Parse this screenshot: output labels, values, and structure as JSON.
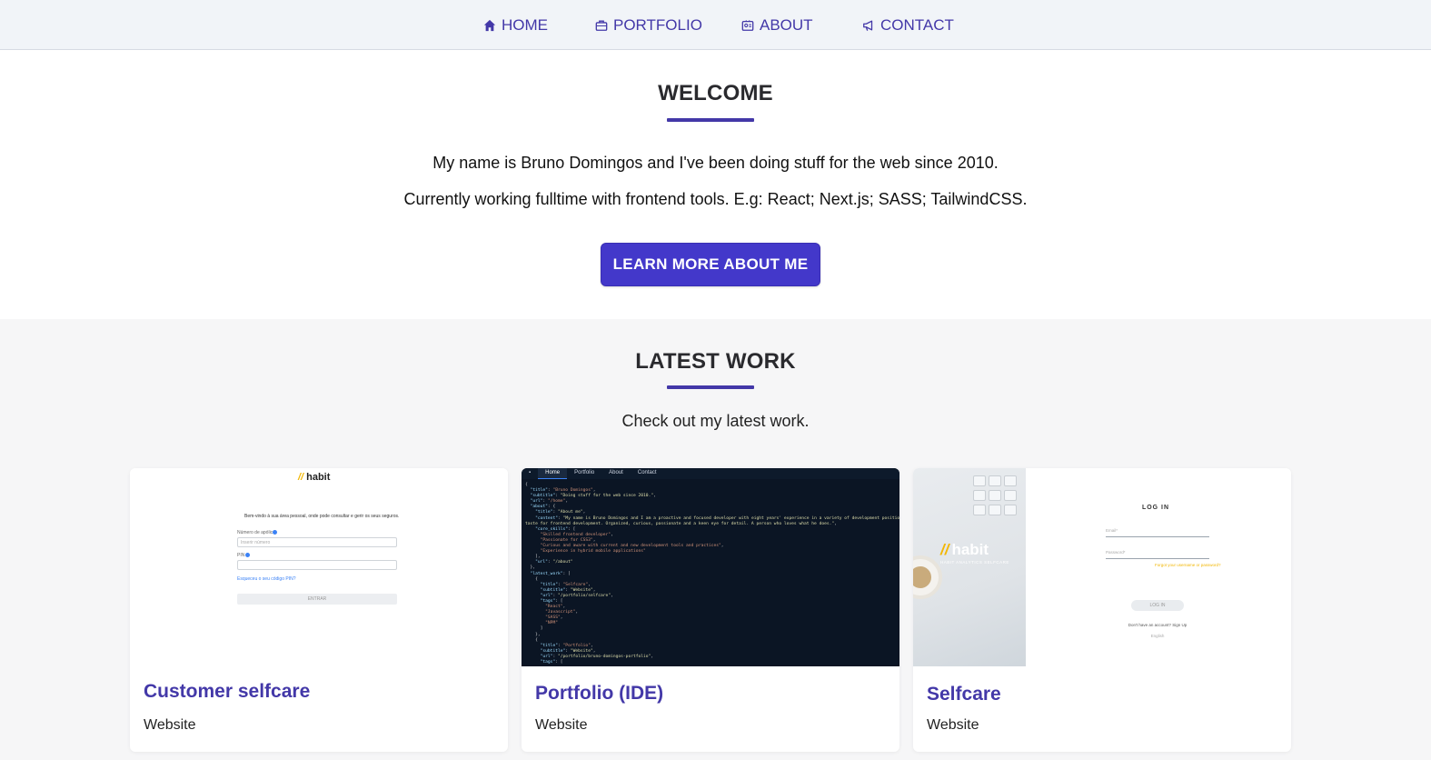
{
  "nav": {
    "items": [
      {
        "label": "HOME",
        "icon": "home-icon"
      },
      {
        "label": "PORTFOLIO",
        "icon": "briefcase-icon"
      },
      {
        "label": "ABOUT",
        "icon": "id-card-icon"
      },
      {
        "label": "CONTACT",
        "icon": "megaphone-icon"
      }
    ]
  },
  "welcome": {
    "title": "WELCOME",
    "line1": "My name is Bruno Domingos and I've been doing stuff for the web since 2010.",
    "line2": "Currently working fulltime with frontend tools. E.g: React; Next.js; SASS; TailwindCSS.",
    "cta": "LEARN MORE ABOUT ME"
  },
  "latest": {
    "title": "LATEST WORK",
    "subtitle": "Check out my latest work.",
    "cards": [
      {
        "title": "Customer selfcare",
        "subtitle": "Website"
      },
      {
        "title": "Portfolio (IDE)",
        "subtitle": "Website"
      },
      {
        "title": "Selfcare",
        "subtitle": "Website"
      }
    ]
  },
  "thumbs": {
    "habit_logo": "habit",
    "habit_welcome": "Bem-vindo à sua área pessoal, onde pode consultar e gerir os seus seguros.",
    "habit_field1": "Número de apólice",
    "habit_field1_ph": "Inserir número",
    "habit_field2": "PIN",
    "habit_link": "Esqueceu o seu código PIN?",
    "habit_btn": "ENTRAR",
    "ide_tabs": [
      "Home",
      "Portfolio",
      "About",
      "Contact"
    ],
    "selfcare_logo": "habit",
    "selfcare_logo_sub": "HABIT ANALYTICS SELFCARE",
    "selfcare_login": "LOG IN",
    "selfcare_email": "Email*",
    "selfcare_password": "Password*",
    "selfcare_forgot": "Forgot your username or password?",
    "selfcare_btn": "LOG IN",
    "selfcare_signup": "Don't have an account? Sign Up",
    "selfcare_lang": "English"
  },
  "colors": {
    "accent": "#4338a8",
    "cta_bg": "#4338ca",
    "nav_bg": "#f1f4f8",
    "section_bg": "#f6f6f7",
    "brand_yellow": "#f2b705"
  }
}
